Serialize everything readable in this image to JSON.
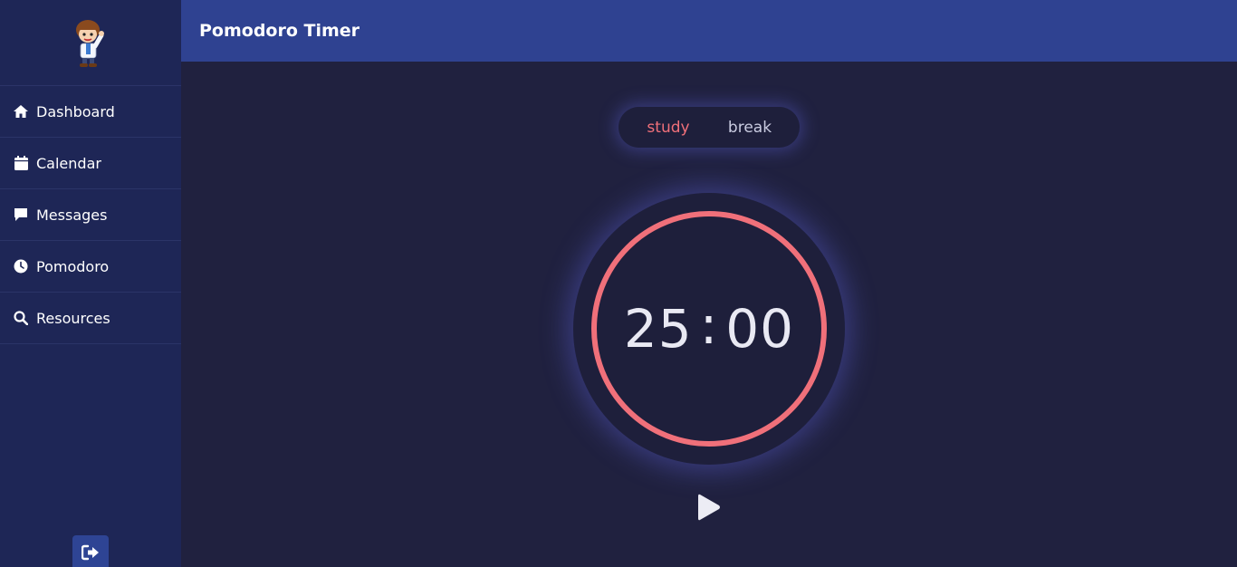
{
  "header": {
    "title": "Pomodoro Timer"
  },
  "sidebar": {
    "items": [
      {
        "label": "Dashboard",
        "icon": "home-icon"
      },
      {
        "label": "Calendar",
        "icon": "calendar-icon"
      },
      {
        "label": "Messages",
        "icon": "message-icon"
      },
      {
        "label": "Pomodoro",
        "icon": "clock-icon"
      },
      {
        "label": "Resources",
        "icon": "search-icon"
      }
    ],
    "logout_icon": "logout-icon"
  },
  "mode": {
    "study_label": "study",
    "break_label": "break",
    "active": "study"
  },
  "timer": {
    "minutes": "25",
    "separator": ":",
    "seconds": "00",
    "progress": 1.0
  },
  "controls": {
    "play_icon": "play-icon"
  },
  "colors": {
    "sidebar": "#1e2656",
    "header": "#2f4291",
    "background": "#20213f",
    "accent": "#f0707a",
    "timer_bg": "#1e1f3b"
  }
}
